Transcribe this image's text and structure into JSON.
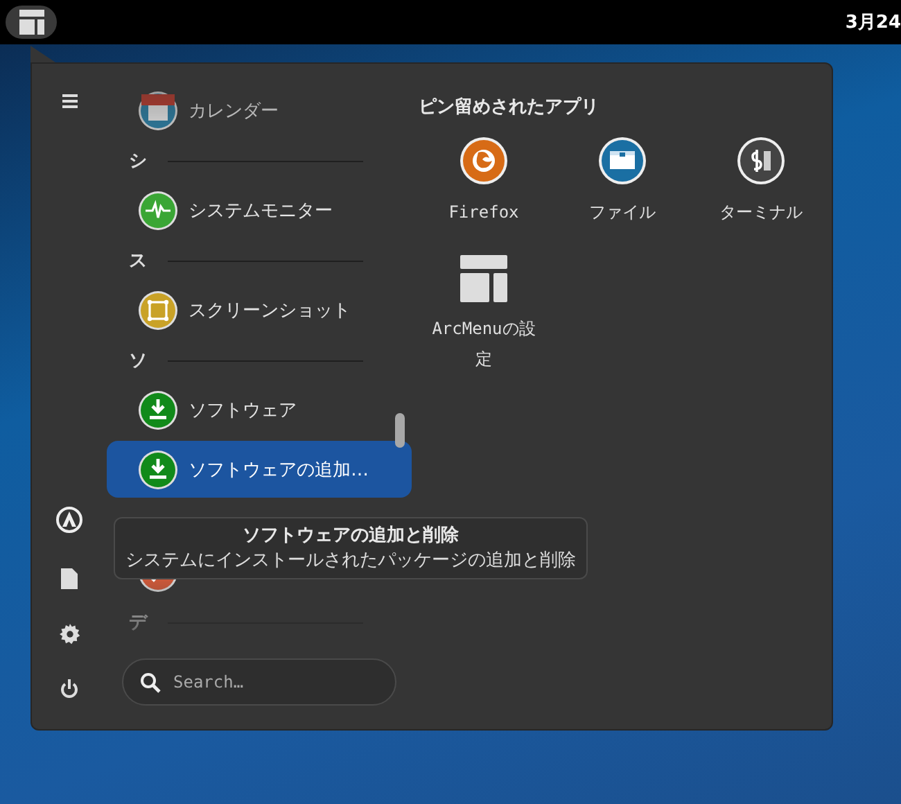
{
  "top_bar": {
    "clock": "3月24"
  },
  "app_list": [
    {
      "kind": "calendar",
      "label": "カレンダー",
      "selected": false
    },
    {
      "kind": "header",
      "label": "シ"
    },
    {
      "kind": "monitor",
      "label": "システムモニター",
      "selected": false
    },
    {
      "kind": "header",
      "label": "ス"
    },
    {
      "kind": "screenshot",
      "label": "スクリーンショット",
      "selected": false
    },
    {
      "kind": "header",
      "label": "ソ"
    },
    {
      "kind": "software",
      "label": "ソフトウェア",
      "selected": false
    },
    {
      "kind": "software",
      "label": "ソフトウェアの追加…",
      "selected": true
    },
    {
      "kind": "editor",
      "selected": false
    },
    {
      "kind": "header",
      "label": "デ"
    }
  ],
  "tooltip": {
    "title": "ソフトウェアの追加と削除",
    "description": "システムにインストールされたパッケージの追加と削除"
  },
  "search": {
    "placeholder": "Search…"
  },
  "pinned": {
    "title": "ピン留めされたアプリ",
    "apps": [
      {
        "kind": "firefox",
        "label": "Firefox"
      },
      {
        "kind": "files",
        "label": "ファイル"
      },
      {
        "kind": "terminal",
        "label": "ターミナル"
      },
      {
        "kind": "arcmenu",
        "label": "ArcMenuの設定"
      }
    ]
  }
}
